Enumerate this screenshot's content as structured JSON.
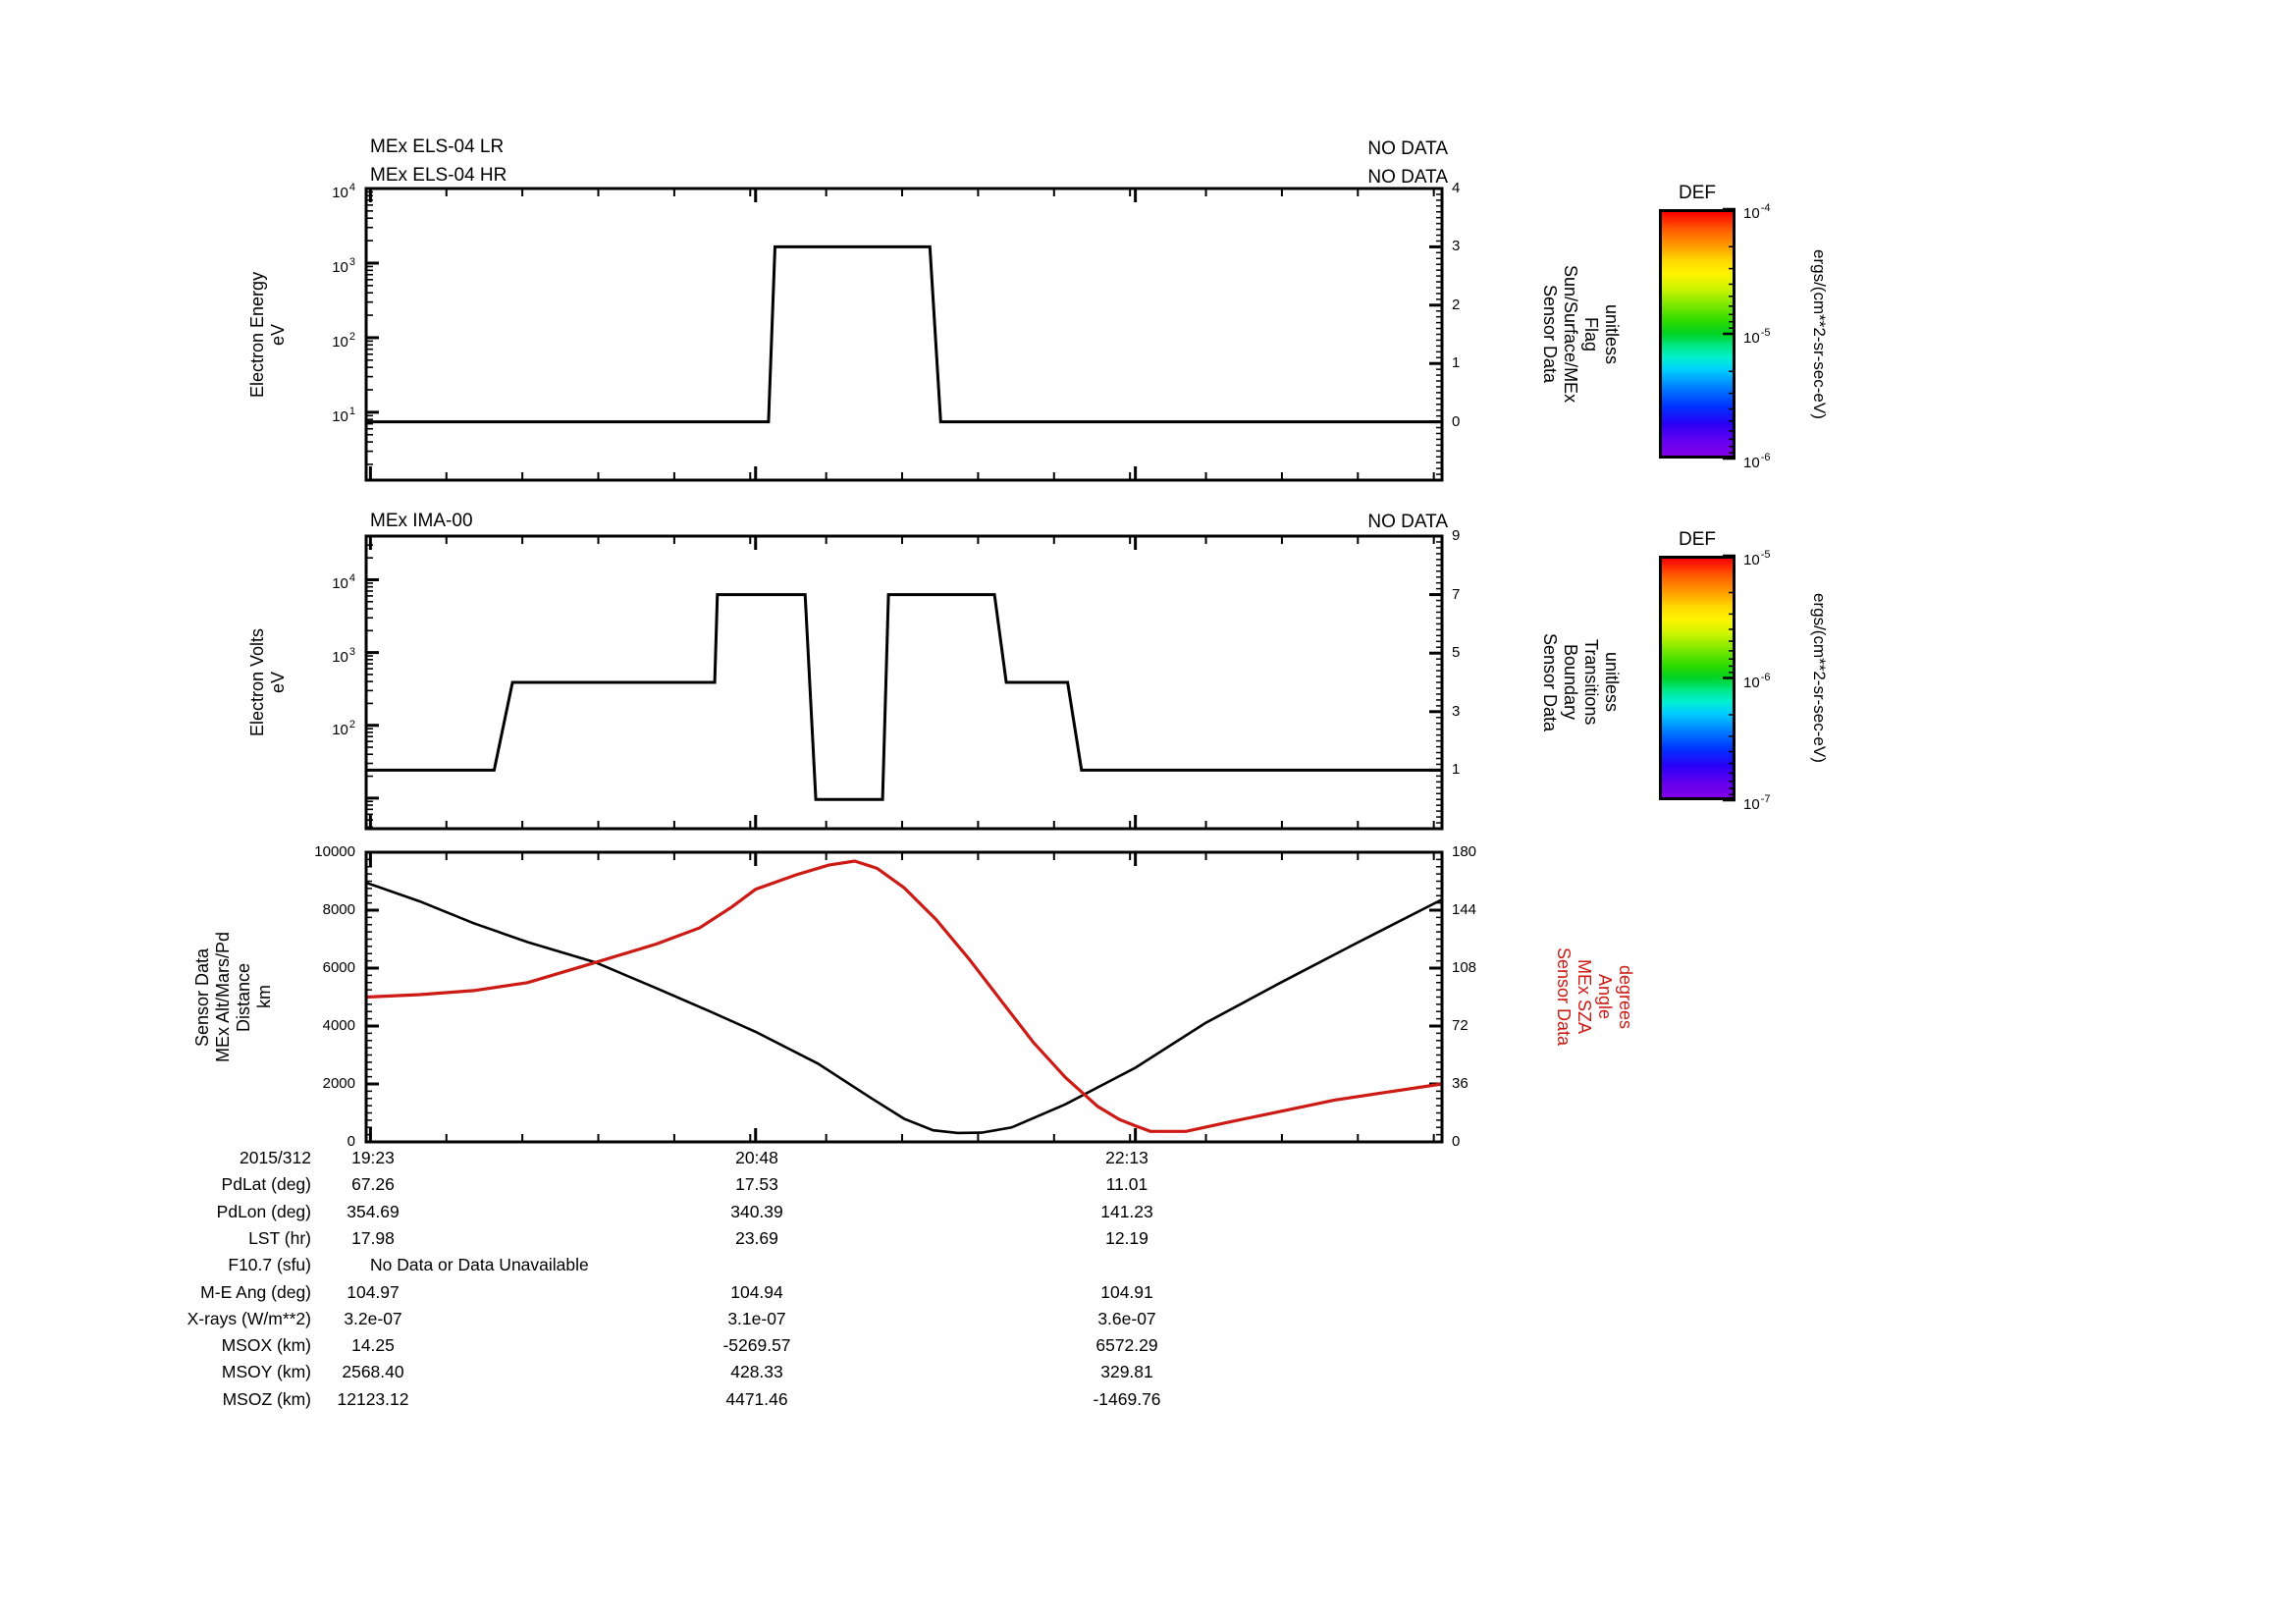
{
  "page": {
    "background": "#ffffff",
    "line_black": "#000000",
    "line_red": "#cc1a14"
  },
  "panels": [
    {
      "titles": [
        "MEx ELS-04 LR",
        "MEx ELS-04 HR"
      ],
      "no_data_labels": [
        "NO DATA",
        "NO DATA"
      ],
      "left_axis": {
        "label": "Electron Energy\neV",
        "scale": "log",
        "labeled_exponents": [
          4,
          3,
          2,
          1
        ],
        "decades": [
          1,
          2,
          3,
          4
        ],
        "log_range": [
          0.09,
          4.0
        ]
      },
      "right_axis": {
        "label": "Sensor Data\nSun/Surface/MEx\nFlag\nunitless",
        "range": [
          -1,
          4
        ],
        "ticks": [
          4,
          3,
          2,
          1,
          0
        ],
        "minor_step": 0.1
      }
    },
    {
      "titles": [
        "MEx IMA-00"
      ],
      "no_data_labels": [
        "NO DATA"
      ],
      "left_axis": {
        "label": "Electron Volts\neV",
        "scale": "log",
        "labeled_exponents": [
          4,
          3,
          2
        ],
        "decades": [
          1,
          2,
          3,
          4
        ],
        "log_range": [
          0.58,
          4.6
        ]
      },
      "right_axis": {
        "label": "Sensor Data\nBoundary\nTransitions\nunitless",
        "range": [
          -1,
          9
        ],
        "ticks": [
          9,
          7,
          5,
          3,
          1
        ],
        "minor_step": 0.2
      }
    },
    {
      "titles": [],
      "no_data_labels": [],
      "left_axis": {
        "label": "Sensor Data\nMEx Alt/Mars/Pd\nDistance\nkm",
        "scale": "linear",
        "range": [
          0,
          10000
        ],
        "ticks": [
          10000,
          8000,
          6000,
          4000,
          2000,
          0
        ],
        "minor_step": 250
      },
      "right_axis": {
        "label": "Sensor Data\nMEx SZA\nAngle\ndegrees",
        "range": [
          0,
          180
        ],
        "ticks": [
          180,
          144,
          108,
          72,
          36,
          0
        ],
        "minor_step": 4.5,
        "color": "#cc1a14"
      }
    }
  ],
  "x_axis": {
    "start_fraction": 0.004,
    "minor_tick_step_fraction": 0.0706,
    "major_tick_fractions": [
      0.004,
      0.362,
      0.715
    ]
  },
  "chart_data": [
    {
      "type": "line",
      "title": "MEx ELS-04 LR / MEx ELS-04 HR",
      "x_labels": [
        "19:23",
        "20:48",
        "22:13"
      ],
      "ylabel_left": "Electron Energy eV (log 10^1..10^4)",
      "ylabel_right": "Sensor Data Sun/Surface/MEx Flag unitless",
      "ylim_right": [
        -1,
        4
      ],
      "series": [
        {
          "name": "Sun/Surface/MEx Flag",
          "axis": "right",
          "color": "#000000",
          "width": 3,
          "points": [
            [
              0,
              0
            ],
            [
              0.374,
              0
            ],
            [
              0.38,
              3
            ],
            [
              0.524,
              3
            ],
            [
              0.534,
              0
            ],
            [
              1,
              0
            ]
          ]
        }
      ]
    },
    {
      "type": "line",
      "title": "MEx IMA-00",
      "x_labels": [
        "19:23",
        "20:48",
        "22:13"
      ],
      "ylabel_left": "Electron Volts eV (log 10^2..10^4)",
      "ylabel_right": "Sensor Data Boundary Transitions unitless",
      "ylim_right": [
        -1,
        9
      ],
      "series": [
        {
          "name": "Boundary Transitions",
          "axis": "right",
          "color": "#000000",
          "width": 3,
          "points": [
            [
              0,
              1
            ],
            [
              0.119,
              1
            ],
            [
              0.136,
              4
            ],
            [
              0.324,
              4
            ],
            [
              0.3265,
              7
            ],
            [
              0.408,
              7
            ],
            [
              0.418,
              0
            ],
            [
              0.48,
              0
            ],
            [
              0.4855,
              7
            ],
            [
              0.584,
              7
            ],
            [
              0.595,
              4
            ],
            [
              0.652,
              4
            ],
            [
              0.665,
              1
            ],
            [
              1,
              1
            ]
          ]
        }
      ]
    },
    {
      "type": "line",
      "title": "",
      "x_labels": [
        "19:23",
        "20:48",
        "22:13"
      ],
      "ylabel_left": "Sensor Data MEx Alt/Mars/Pd Distance km",
      "ylabel_right": "Sensor Data MEx SZA Angle degrees",
      "ylim_left": [
        0,
        10000
      ],
      "ylim_right": [
        0,
        180
      ],
      "series": [
        {
          "name": "MEx Alt/Mars/Pd Distance (km)",
          "axis": "left",
          "color": "#000000",
          "width": 2.6,
          "points": [
            [
              0,
              8950
            ],
            [
              0.05,
              8300
            ],
            [
              0.1,
              7550
            ],
            [
              0.15,
              6900
            ],
            [
              0.213,
              6200
            ],
            [
              0.27,
              5300
            ],
            [
              0.32,
              4500
            ],
            [
              0.362,
              3800
            ],
            [
              0.42,
              2700
            ],
            [
              0.47,
              1500
            ],
            [
              0.5,
              800
            ],
            [
              0.527,
              400
            ],
            [
              0.55,
              310
            ],
            [
              0.572,
              320
            ],
            [
              0.6,
              500
            ],
            [
              0.65,
              1300
            ],
            [
              0.715,
              2560
            ],
            [
              0.78,
              4100
            ],
            [
              0.85,
              5500
            ],
            [
              0.92,
              6850
            ],
            [
              1,
              8370
            ]
          ]
        },
        {
          "name": "MEx SZA Angle (degrees)",
          "axis": "right",
          "color": "#cc1a14",
          "width": 3.2,
          "points": [
            [
              0,
              90
            ],
            [
              0.05,
              91.5
            ],
            [
              0.1,
              94
            ],
            [
              0.15,
              99
            ],
            [
              0.213,
              111.5
            ],
            [
              0.27,
              123
            ],
            [
              0.31,
              133
            ],
            [
              0.34,
              146
            ],
            [
              0.362,
              157
            ],
            [
              0.4,
              166
            ],
            [
              0.43,
              172
            ],
            [
              0.454,
              174.5
            ],
            [
              0.475,
              170
            ],
            [
              0.5,
              158
            ],
            [
              0.53,
              138
            ],
            [
              0.56,
              114
            ],
            [
              0.59,
              88
            ],
            [
              0.62,
              62
            ],
            [
              0.65,
              40
            ],
            [
              0.68,
              22
            ],
            [
              0.7,
              14
            ],
            [
              0.715,
              10
            ],
            [
              0.729,
              6.5
            ],
            [
              0.762,
              6.5
            ],
            [
              0.8,
              12
            ],
            [
              0.85,
              19
            ],
            [
              0.9,
              26
            ],
            [
              0.95,
              31
            ],
            [
              1,
              36
            ]
          ]
        }
      ]
    }
  ],
  "colorbars": [
    {
      "title": "DEF",
      "unit_label": "ergs/(cm**2-sr-sec-eV)",
      "tick_exponents": [
        -4,
        -5,
        -6
      ]
    },
    {
      "title": "DEF",
      "unit_label": "ergs/(cm**2-sr-sec-eV)",
      "tick_exponents": [
        -5,
        -6,
        -7
      ]
    }
  ],
  "table": {
    "rows": [
      {
        "label": "2015/312",
        "values": [
          "19:23",
          "20:48",
          "22:13"
        ]
      },
      {
        "label": "PdLat (deg)",
        "values": [
          "67.26",
          "17.53",
          "11.01"
        ]
      },
      {
        "label": "PdLon (deg)",
        "values": [
          "354.69",
          "340.39",
          "141.23"
        ]
      },
      {
        "label": "LST (hr)",
        "values": [
          "17.98",
          "23.69",
          "12.19"
        ]
      },
      {
        "label": "F10.7 (sfu)",
        "note": "No Data or Data Unavailable"
      },
      {
        "label": "M-E Ang (deg)",
        "values": [
          "104.97",
          "104.94",
          "104.91"
        ]
      },
      {
        "label": "X-rays (W/m**2)",
        "values": [
          "3.2e-07",
          "3.1e-07",
          "3.6e-07"
        ]
      },
      {
        "label": "MSOX (km)",
        "values": [
          "14.25",
          "-5269.57",
          "6572.29"
        ]
      },
      {
        "label": "MSOY (km)",
        "values": [
          "2568.40",
          "428.33",
          "329.81"
        ]
      },
      {
        "label": "MSOZ (km)",
        "values": [
          "12123.12",
          "4471.46",
          "-1469.76"
        ]
      }
    ]
  }
}
